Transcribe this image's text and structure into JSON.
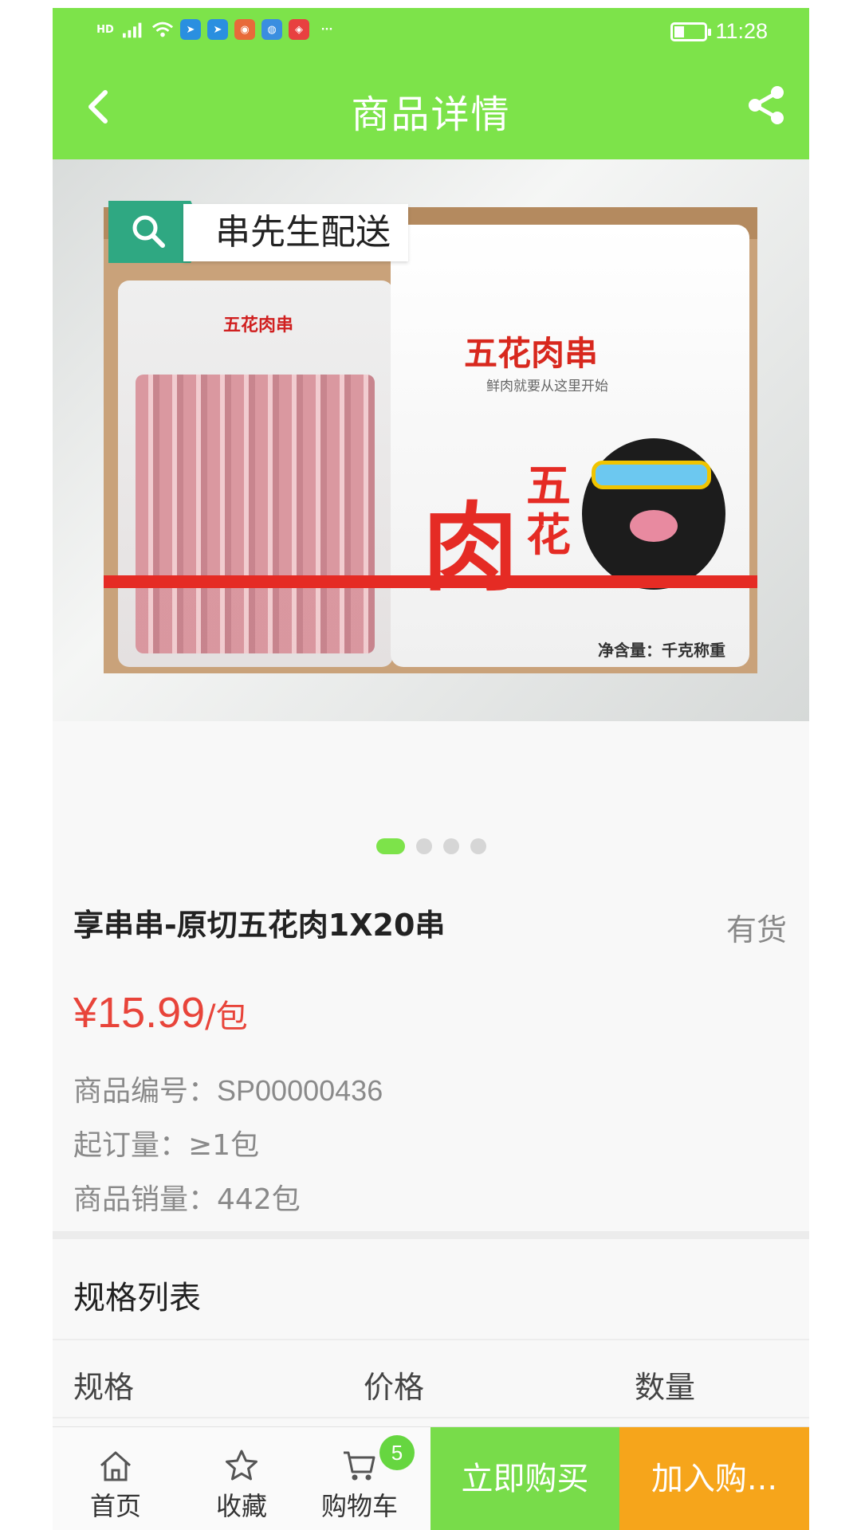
{
  "status_bar": {
    "hd": "HD",
    "signal": "5G",
    "time": "11:28",
    "apps": [
      "telegram-icon",
      "telegram-icon",
      "app-icon",
      "browser-icon",
      "app-icon"
    ],
    "more": "···"
  },
  "header": {
    "title": "商品详情"
  },
  "gallery": {
    "overlay_label": "串先生配送",
    "bag_small_label": "五花肉串",
    "bag_title": "五花肉串",
    "bag_sub": "鲜肉就要从这里开始",
    "big_char": "肉",
    "side_chars": "五花",
    "net_weight": "净含量：千克称重",
    "slides_total": 4,
    "active_slide": 1
  },
  "product": {
    "name": "享串串-原切五花肉1X20串",
    "stock": "有货",
    "price": "¥15.99",
    "unit": "/包",
    "code_label": "商品编号：",
    "code_value": "SP00000436",
    "moq_label": "起订量：",
    "moq_value": "≥1包",
    "sales_label": "商品销量：",
    "sales_value": "442包"
  },
  "spec": {
    "title": "规格列表",
    "columns": [
      "规格",
      "价格",
      "数量"
    ]
  },
  "bottom_bar": {
    "home": "首页",
    "favorite": "收藏",
    "cart": "购物车",
    "cart_count": "5",
    "buy_now": "立即购买",
    "add_cart": "加入购..."
  },
  "colors": {
    "brand_green": "#7de34a",
    "price_red": "#e8443a",
    "cart_orange": "#f6a51b"
  }
}
